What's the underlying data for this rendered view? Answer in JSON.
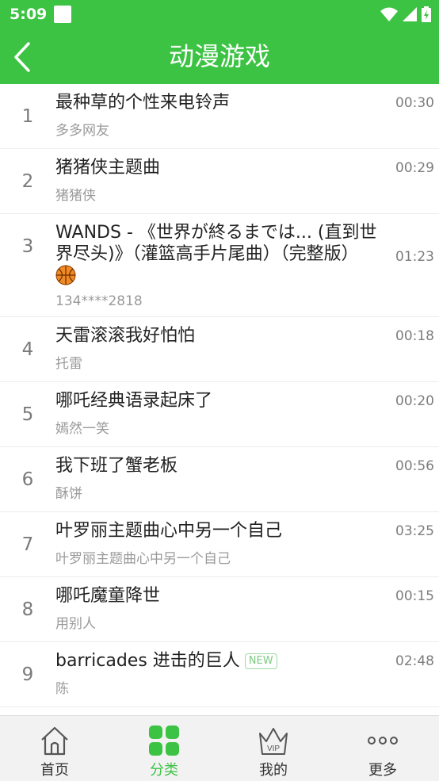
{
  "status_bar": {
    "time": "5:09"
  },
  "header": {
    "title": "动漫游戏"
  },
  "songs": [
    {
      "num": "1",
      "title": "最种草的个性来电铃声",
      "artist": "多多网友",
      "duration": "00:30"
    },
    {
      "num": "2",
      "title": "猪猪侠主题曲",
      "artist": "猪猪侠",
      "duration": "00:29"
    },
    {
      "num": "3",
      "title_line1": "WANDS - 《世界が終るまでは... (直到世",
      "title_line2": "界尽头)》（灌篮高手片尾曲）（完整版）",
      "artist": "134****2818",
      "duration": "01:23"
    },
    {
      "num": "4",
      "title": "天雷滚滚我好怕怕",
      "artist": "托雷",
      "duration": "00:18"
    },
    {
      "num": "5",
      "title": "哪吒经典语录起床了",
      "artist": "嫣然一笑",
      "duration": "00:20"
    },
    {
      "num": "6",
      "title": "我下班了蟹老板",
      "artist": "酥饼",
      "duration": "00:56"
    },
    {
      "num": "7",
      "title": "叶罗丽主题曲心中另一个自己",
      "artist": "叶罗丽主题曲心中另一个自己",
      "duration": "03:25"
    },
    {
      "num": "8",
      "title": "哪吒魔童降世",
      "artist": "用别人",
      "duration": "00:15"
    },
    {
      "num": "9",
      "title": "barricades 进击的巨人",
      "badge": "NEW",
      "artist": "陈",
      "duration": "02:48"
    }
  ],
  "tabs": [
    {
      "label": "首页",
      "icon": "home-icon",
      "active": false
    },
    {
      "label": "分类",
      "icon": "category-grid-icon",
      "active": true
    },
    {
      "label": "我的",
      "icon": "vip-crown-icon",
      "active": false
    },
    {
      "label": "更多",
      "icon": "more-dots-icon",
      "active": false
    }
  ],
  "colors": {
    "accent": "#3cc343",
    "tab_bg": "#f2f2f2"
  }
}
